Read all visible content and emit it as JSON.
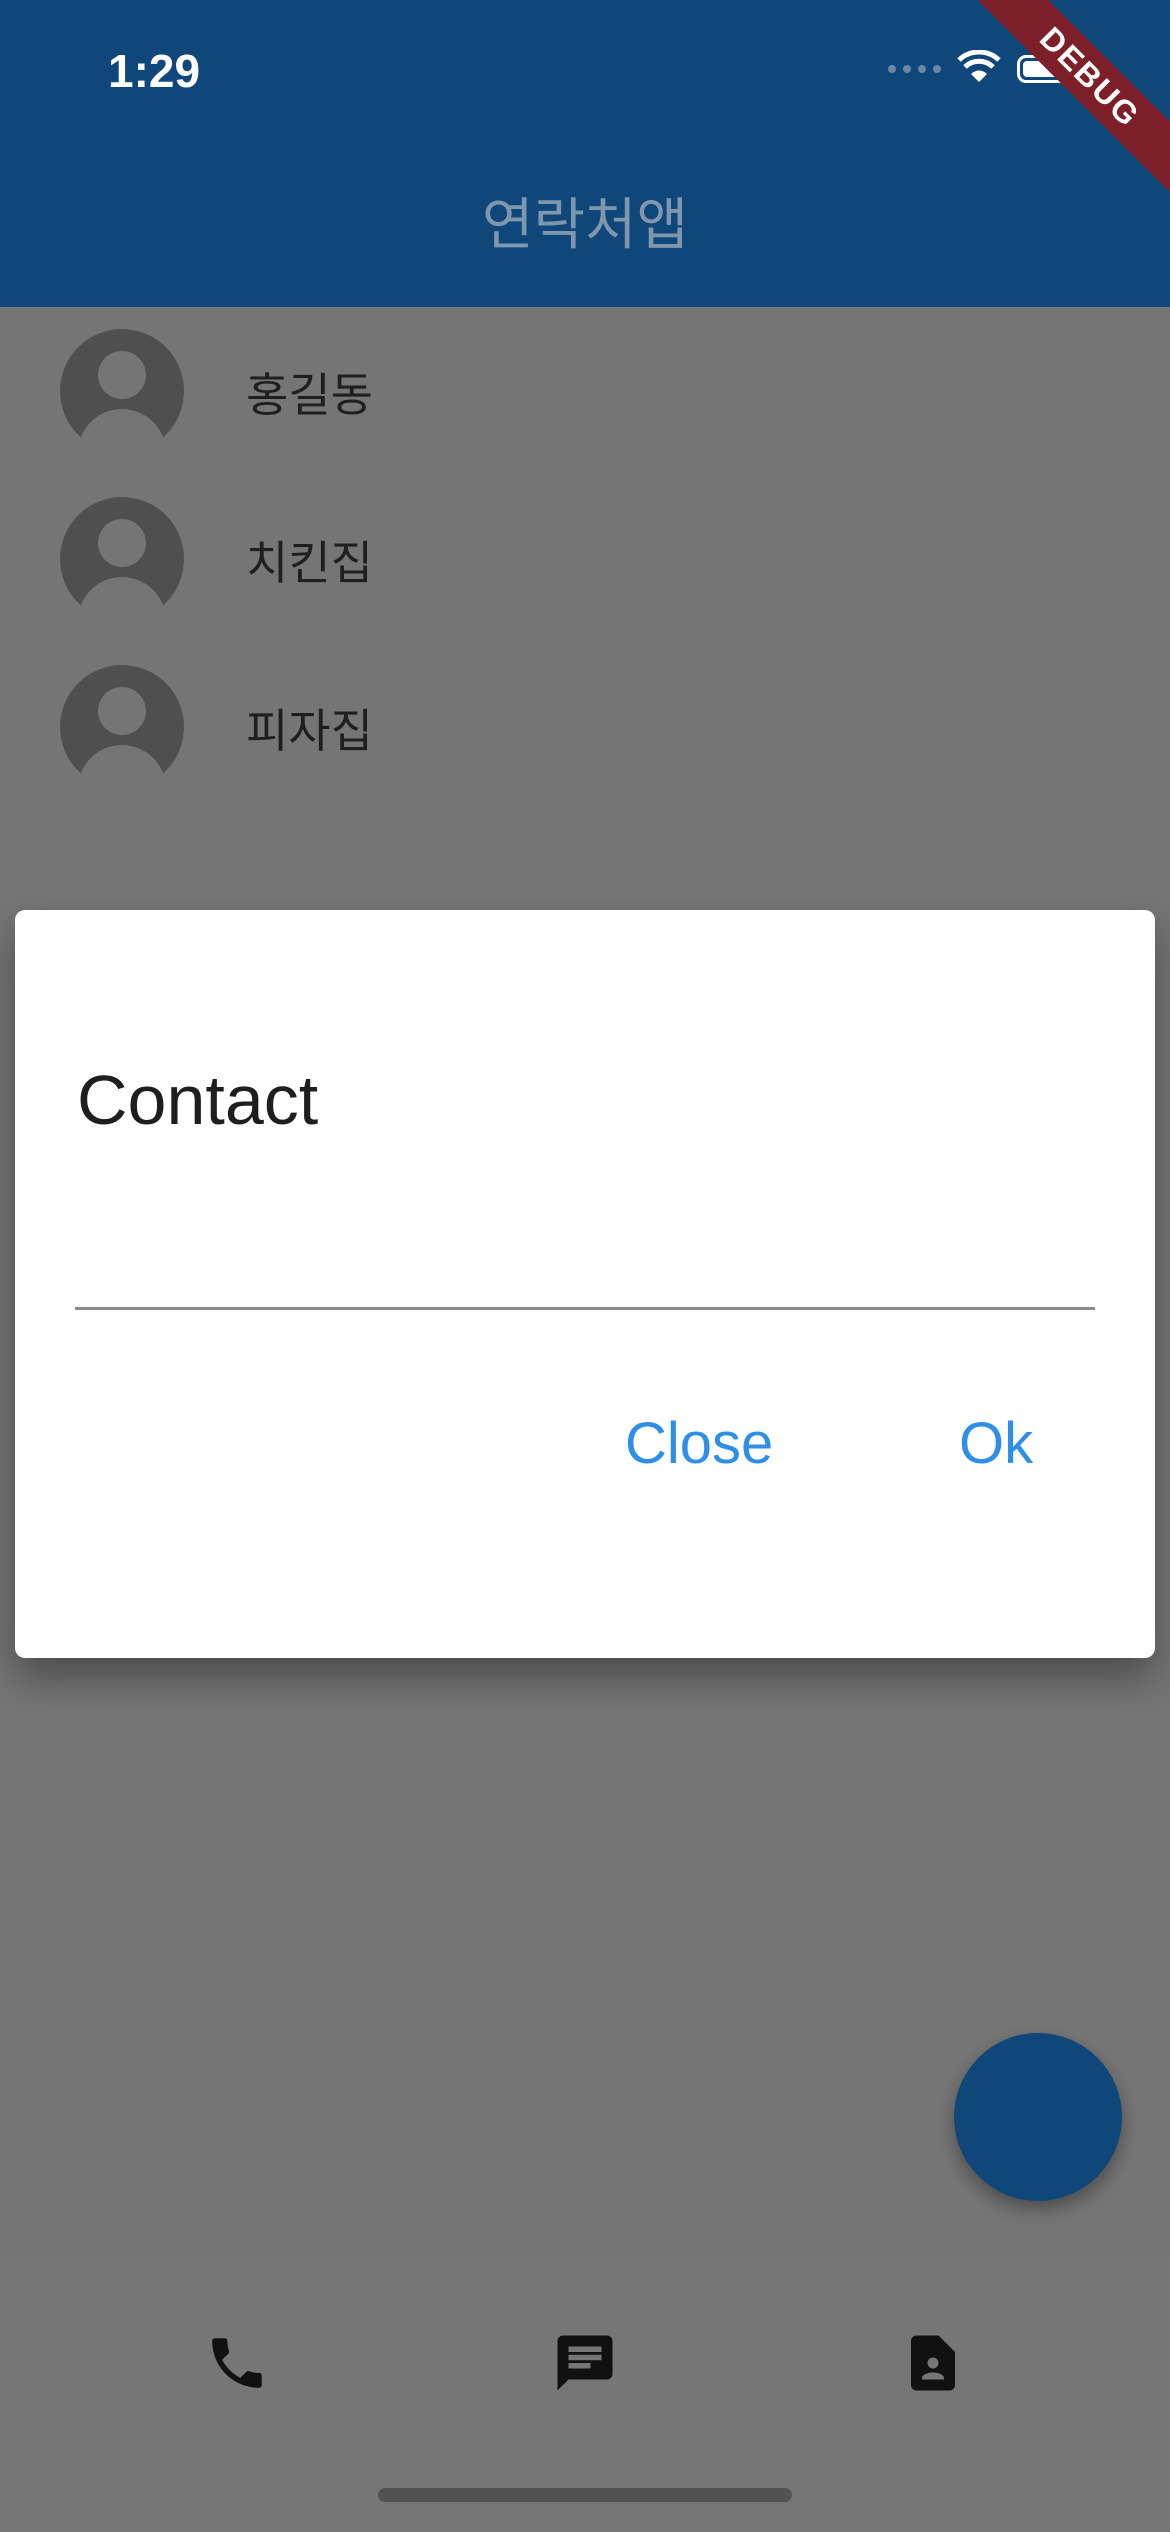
{
  "status_bar": {
    "time": "1:29"
  },
  "app_bar": {
    "title": "연락처앱",
    "debug_label": "DEBUG"
  },
  "contacts": [
    {
      "name": "홍길동"
    },
    {
      "name": "치킨집"
    },
    {
      "name": "피자집"
    }
  ],
  "dialog": {
    "title": "Contact",
    "input_value": "",
    "close_label": "Close",
    "ok_label": "Ok"
  },
  "colors": {
    "app_bar": "#0f477a",
    "accent": "#2f8fe6",
    "scrim": "#757575"
  },
  "icons": {
    "status": [
      "signal-icon",
      "wifi-icon",
      "battery-icon"
    ],
    "nav": [
      "phone-icon",
      "message-icon",
      "contact-card-icon"
    ]
  }
}
